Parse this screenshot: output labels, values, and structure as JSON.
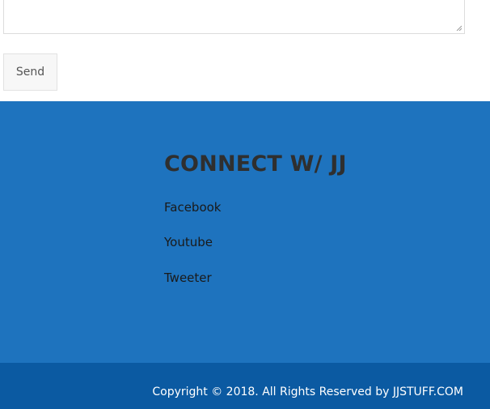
{
  "form": {
    "message_value": "",
    "send_label": "Send"
  },
  "connect": {
    "title": "CONNECT W/ JJ",
    "links": [
      {
        "label": "Facebook"
      },
      {
        "label": "Youtube"
      },
      {
        "label": "Tweeter"
      }
    ]
  },
  "footer": {
    "copyright": "Copyright © 2018. All Rights Reserved by JJSTUFF.COM"
  },
  "colors": {
    "section_blue": "#1e73be",
    "footer_blue": "#0b5aa2",
    "title_text": "#2f2f2f"
  }
}
